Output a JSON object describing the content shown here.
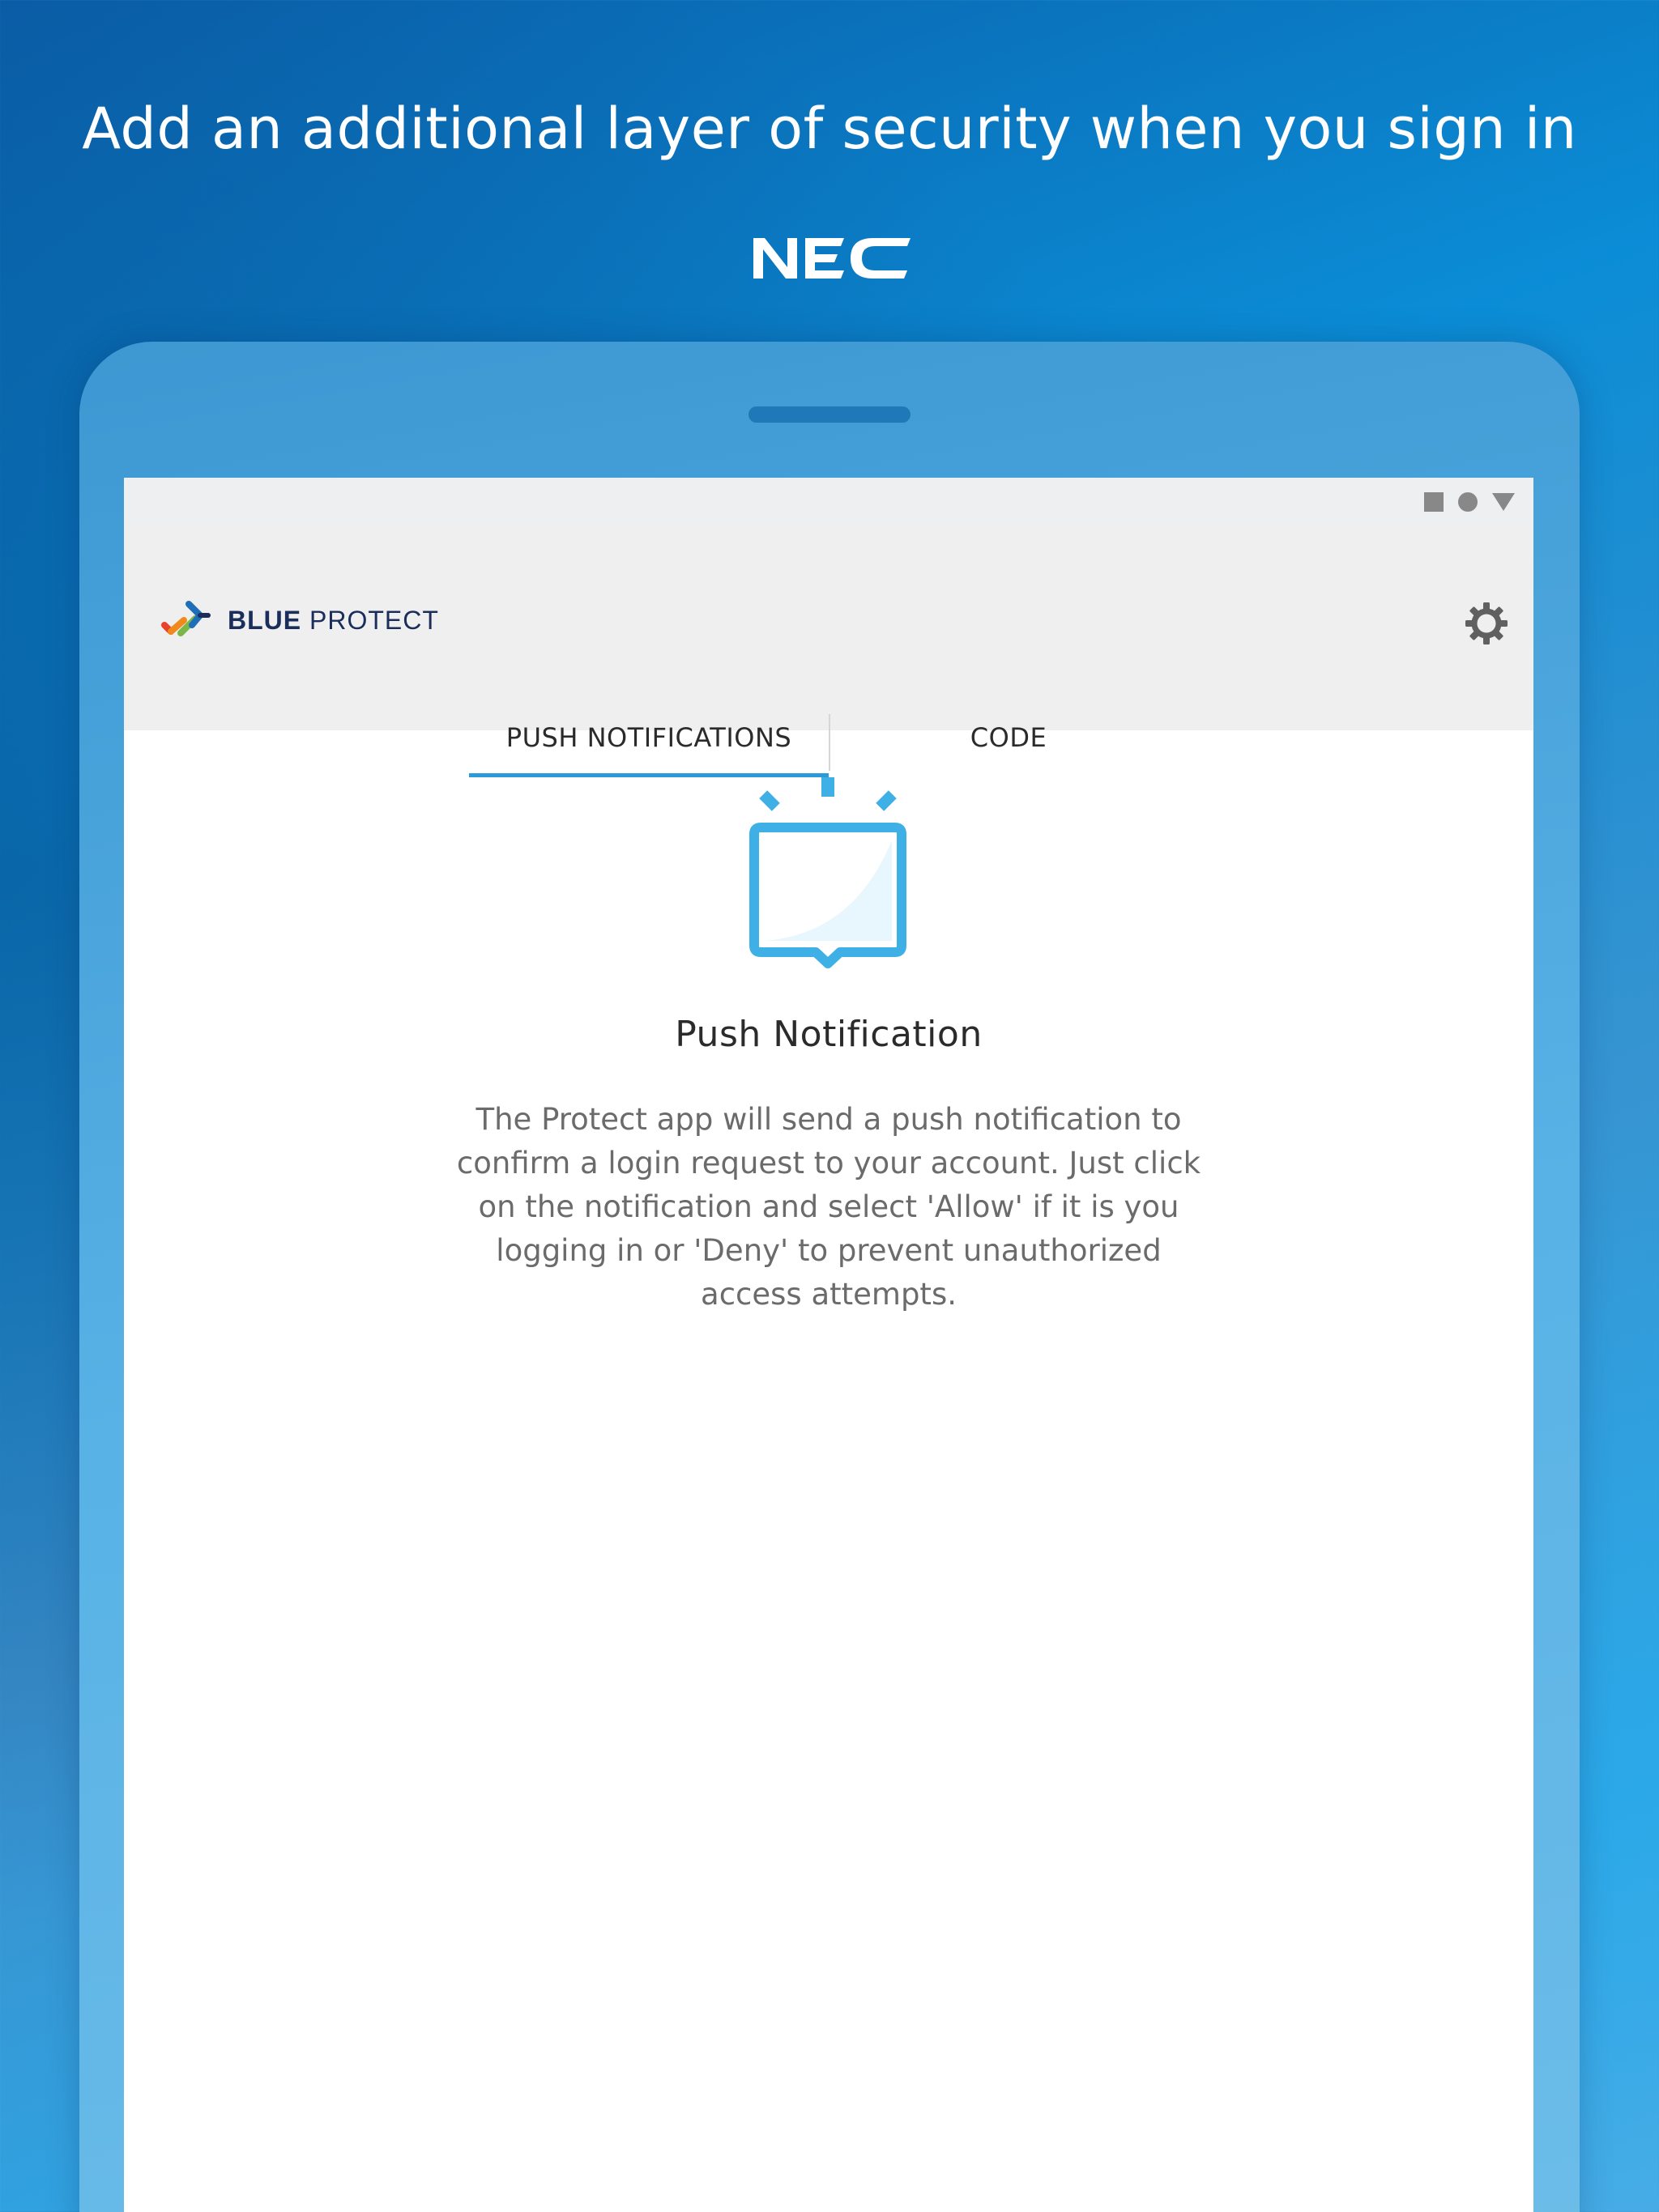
{
  "headline": "Add an additional layer of security when you sign in",
  "brand_logo": "NEC",
  "app": {
    "brand_bold": "BLUE",
    "brand_light": " PROTECT",
    "settings_icon": "gear-icon"
  },
  "tabs": [
    {
      "label": "PUSH NOTIFICATIONS",
      "active": true
    },
    {
      "label": "CODE",
      "active": false
    }
  ],
  "content": {
    "title": "Push Notification",
    "body": "The Protect app will send a push notification to confirm a login request to your account. Just click on the notification and select 'Allow' if it is you logging in or 'Deny' to prevent unauthorized access attempts."
  },
  "colors": {
    "accent": "#2a9ad8",
    "illustration": "#3fb0e6",
    "brand_navy": "#1b2d5a"
  }
}
